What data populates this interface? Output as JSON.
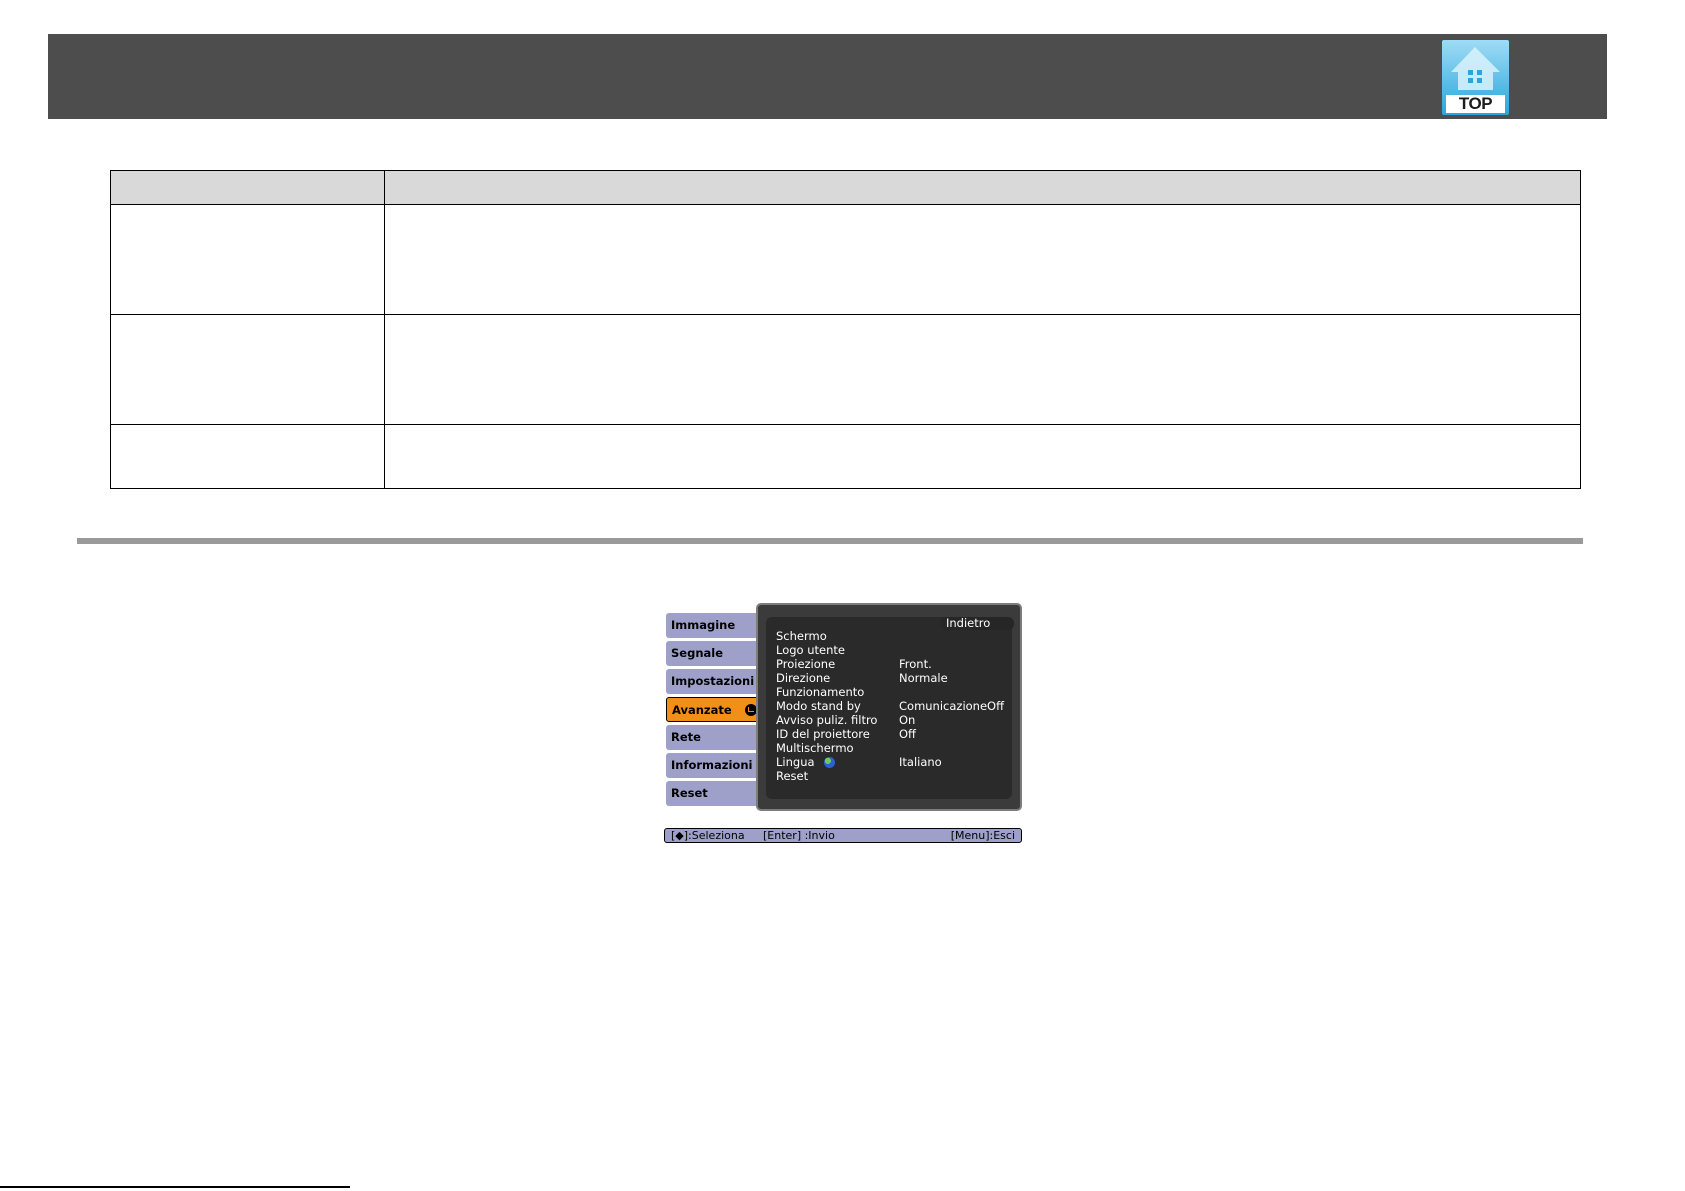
{
  "header": {
    "top_button_label": "TOP"
  },
  "table": {
    "columns": [
      "",
      ""
    ],
    "rows": [
      [
        "",
        ""
      ],
      [
        "",
        ""
      ],
      [
        "",
        ""
      ]
    ]
  },
  "osd": {
    "tabs": [
      {
        "label": "Immagine"
      },
      {
        "label": "Segnale"
      },
      {
        "label": "Impostazioni"
      },
      {
        "label": "Avanzate",
        "active": true
      },
      {
        "label": "Rete"
      },
      {
        "label": "Informazioni"
      },
      {
        "label": "Reset"
      }
    ],
    "back_label": "Indietro",
    "items": [
      {
        "label": "Schermo",
        "value": ""
      },
      {
        "label": "Logo utente",
        "value": ""
      },
      {
        "label": "Proiezione",
        "value": "Front."
      },
      {
        "label": "Direzione",
        "value": "Normale"
      },
      {
        "label": "Funzionamento",
        "value": ""
      },
      {
        "label": "Modo stand by",
        "value": "ComunicazioneOff"
      },
      {
        "label": "Avviso puliz. filtro",
        "value": "On"
      },
      {
        "label": "ID del proiettore",
        "value": "Off"
      },
      {
        "label": "Multischermo",
        "value": ""
      },
      {
        "label": "Lingua",
        "value": "Italiano",
        "icon": "globe-icon"
      },
      {
        "label": "Reset",
        "value": ""
      }
    ],
    "footer": {
      "select_hint": "[◆]:Seleziona",
      "enter_hint": "[Enter] :Invio",
      "exit_hint": "[Menu]:Esci"
    }
  },
  "colors": {
    "header_bg": "#4d4d4d",
    "tab_bg": "#9ea0c9",
    "active_tab_bg": "#f28f16",
    "panel_bg": "#2a2a2a"
  }
}
